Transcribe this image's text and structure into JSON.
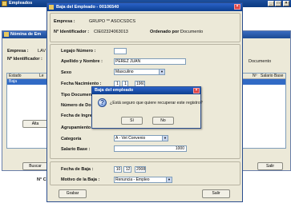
{
  "top_bar": {
    "title": "Empleados"
  },
  "bg_window": {
    "title": "Nómina de Em",
    "labels": {
      "empresa": "Empresa :",
      "empresa_value": "LAV",
      "identificador": "Nº Identificador :",
      "documento": "Documento"
    },
    "table_headers": [
      "Estado",
      "Le",
      "Nº",
      "Salario Base"
    ],
    "table_row": {
      "estado": "Baja"
    },
    "buttons": {
      "alta": "Alta",
      "buscar": "Buscar",
      "salir": "Salir"
    },
    "footer_text": "N° C"
  },
  "main_window": {
    "title": "Baja del Empleado - 00106540",
    "header": {
      "empresa_label": "Empresa :",
      "empresa_value": "GRUPO ** ASOCSDCS",
      "identificador_label": "N° Identificador :",
      "identificador_value": "CIE02324063013",
      "ordenado_label": "Ordenado por :",
      "ordenado_value": "Documento"
    },
    "fields": {
      "legajo_label": "Legajo Número :",
      "legajo_value": "",
      "apellido_label": "Apellido y Nombre :",
      "apellido_value": "PEREZ JUAN",
      "sexo_label": "Sexo",
      "sexo_value": "Masculino",
      "fecha_nac_label": "Fecha Nacimiento :",
      "fecha_nac_day": "1",
      "fecha_nac_month": "1",
      "fecha_nac_year": "1960",
      "tipo_doc_label": "Tipo Documento",
      "numero_doc_label": "Número de Do",
      "fecha_ingreso_label": "Fecha de Ingre",
      "agrupamiento_label": "Agrupamiento",
      "categoria_label": "Categoría",
      "categoria_value": "A - Vet Convenio",
      "salario_label": "Salario Base :",
      "salario_value": "1000"
    },
    "baja": {
      "fecha_label": "Fecha de Baja :",
      "fecha_day": "10",
      "fecha_month": "12",
      "fecha_year": "2008",
      "motivo_label": "Motivo de la Baja :",
      "motivo_value": "Renuncia - Empleo"
    },
    "buttons": {
      "grabar": "Grabar",
      "salir": "Salir"
    }
  },
  "dialog": {
    "title": "Baja del empleado",
    "message": "¿Está seguro que quiere recuperar este registro?",
    "yes": "Sí",
    "no": "No"
  }
}
